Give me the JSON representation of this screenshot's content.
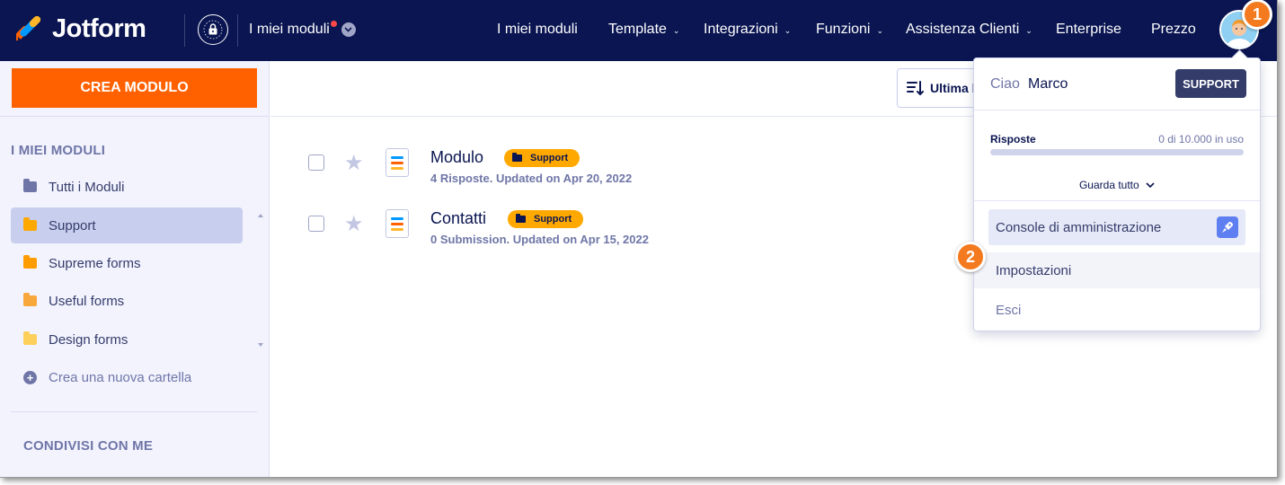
{
  "brand": {
    "name": "Jotform",
    "accent": "#ff6100",
    "navy": "#0a1551"
  },
  "topbar": {
    "workspace_label": "I miei moduli",
    "nav": [
      {
        "label": "I miei moduli",
        "has_caret": false
      },
      {
        "label": "Template",
        "has_caret": true
      },
      {
        "label": "Integrazioni",
        "has_caret": true
      },
      {
        "label": "Funzioni",
        "has_caret": true
      },
      {
        "label": "Assistenza Clienti",
        "has_caret": true
      },
      {
        "label": "Enterprise",
        "has_caret": false
      },
      {
        "label": "Prezzo",
        "has_caret": false
      }
    ],
    "icons": [
      "lock-shield-icon",
      "chevron-down-icon",
      "avatar-icon"
    ]
  },
  "step_badges": [
    "1",
    "2"
  ],
  "sidebar": {
    "create_button": "CREA MODULO",
    "section_my_forms": "I MIEI MODULI",
    "folders": [
      {
        "label": "Tutti i Moduli",
        "color": "#6f76a7",
        "active": false
      },
      {
        "label": "Support",
        "color": "#ffa800",
        "active": true
      },
      {
        "label": "Supreme forms",
        "color": "#ff9d00",
        "active": false
      },
      {
        "label": "Useful forms",
        "color": "#f8a73b",
        "active": false
      },
      {
        "label": "Design forms",
        "color": "#fdd05b",
        "active": false
      }
    ],
    "new_folder": "Crea una nuova cartella",
    "section_shared": "CONDIVISI CON ME"
  },
  "toolbar": {
    "sort_label": "Ultima l"
  },
  "forms": [
    {
      "title": "Modulo",
      "tag": "Support",
      "meta": "4 Risposte. Updated on Apr 20, 2022"
    },
    {
      "title": "Contatti",
      "tag": "Support",
      "meta": "0 Submission. Updated on Apr 15, 2022"
    }
  ],
  "dropdown": {
    "greeting": "Ciao",
    "user_name": "Marco",
    "plan_badge": "SUPPORT",
    "usage_label": "Risposte",
    "usage_text": "0 di 10.000 in uso",
    "usage_fraction": 0,
    "view_all": "Guarda tutto",
    "items": {
      "admin": "Console di amministrazione",
      "settings": "Impostazioni",
      "logout": "Esci"
    }
  }
}
